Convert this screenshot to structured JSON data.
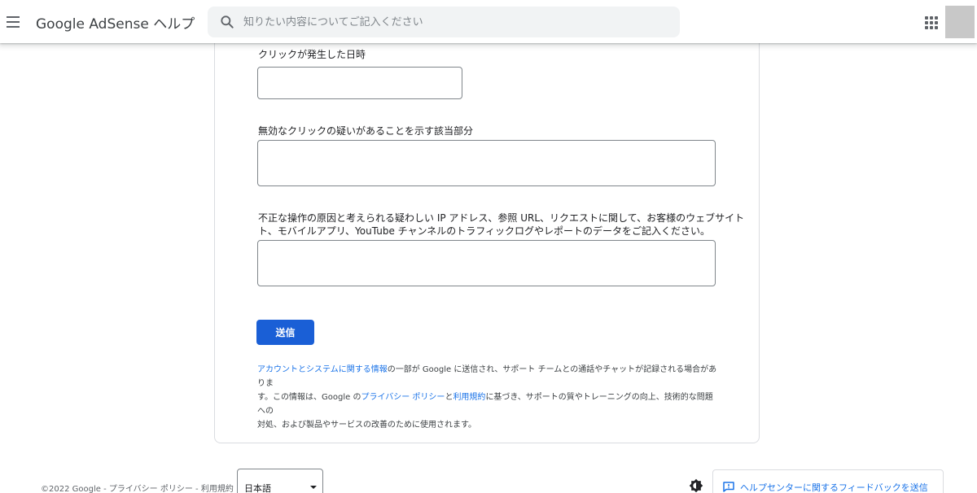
{
  "header": {
    "app_title": "Google AdSense ヘルプ",
    "search_placeholder": "知りたい内容についてご記入ください",
    "menu_icon": "hamburger-menu-icon",
    "apps_icon": "google-apps-icon"
  },
  "form": {
    "click_datetime_label": "クリックが発生した日時",
    "invalid_click_part_label": "無効なクリックの疑いがあることを示す該当部分",
    "suspicious_data_label_line1": "不正な操作の原因と考えられる疑わしい IP アドレス、参照 URL、リクエストに関して、お客様のウェブサイト",
    "suspicious_data_label_line2": "ト、モバイルアプリ、YouTube チャンネルのトラフィックログやレポートのデータをご記入ください。",
    "submit_label": "送信"
  },
  "notice": {
    "link_account_info": "アカウントとシステムに関する情報",
    "text_1": "の一部が Google に送信され、サポート チームとの通話やチャットが記録される場合がありま",
    "text_2": "す。この情報は、Google の",
    "link_privacy": "プライバシー ポリシー",
    "text_3": "と",
    "link_terms": "利用規約",
    "text_4": "に基づき、サポートの質やトレーニングの向上、技術的な問題への",
    "text_5": "対処、および製品やサービスの改善のために使用されます。"
  },
  "footer": {
    "copyright": "©2022 Google",
    "sep": " - ",
    "privacy": "プライバシー ポリシー",
    "terms": "利用規約",
    "language": "日本語",
    "feedback_label": "ヘルプセンターに関するフィードバックを送信"
  },
  "colors": {
    "accent": "#1a5fd6",
    "link": "#1a73e8"
  }
}
